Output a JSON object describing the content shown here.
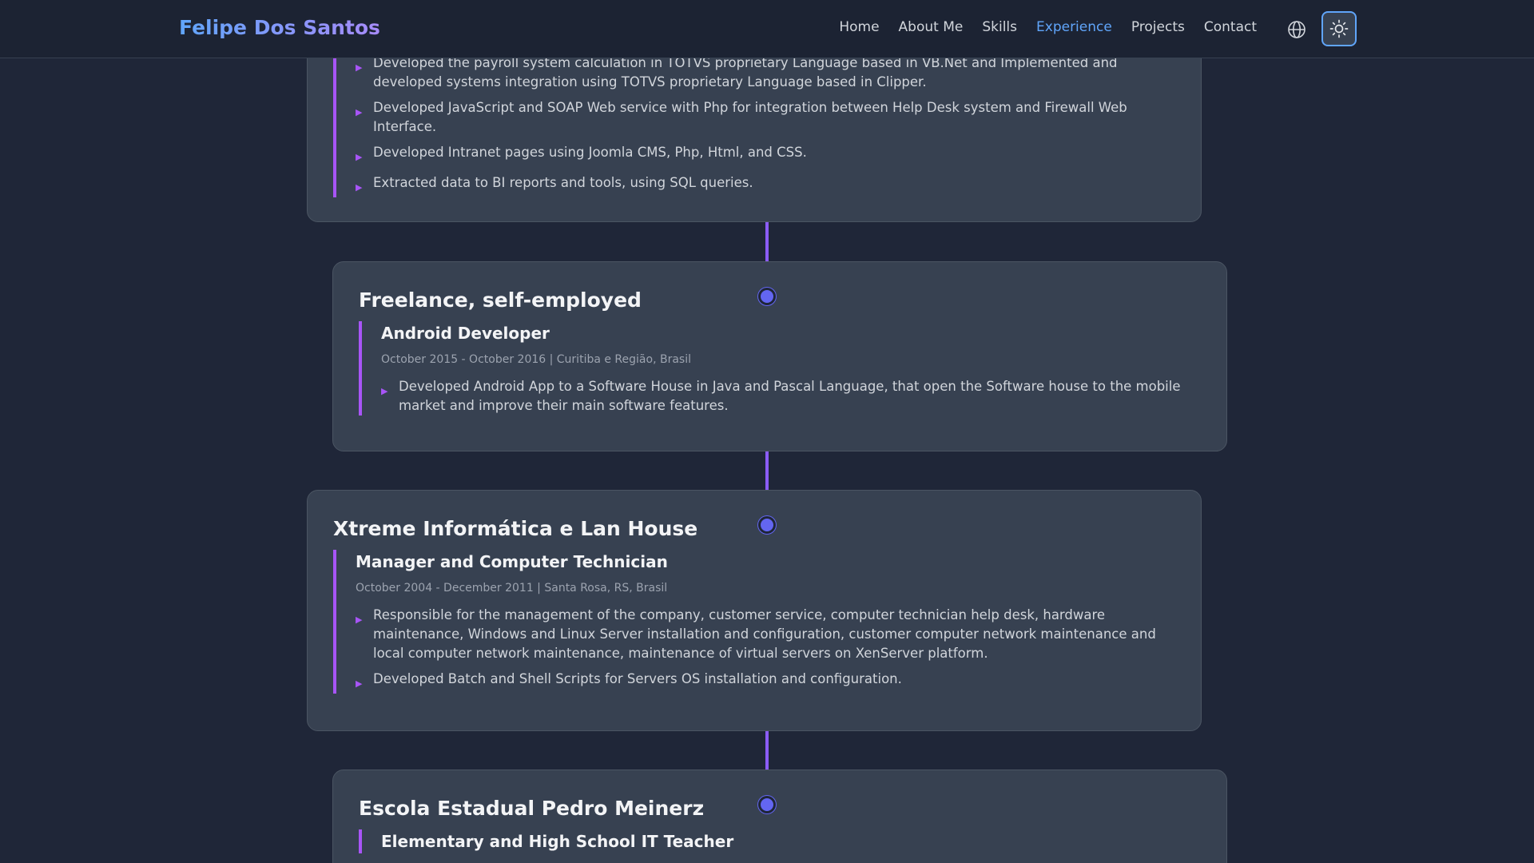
{
  "nav": {
    "brand": "Felipe Dos Santos",
    "links": [
      "Home",
      "About Me",
      "Skills",
      "Experience",
      "Projects",
      "Contact"
    ],
    "active_link": "Experience",
    "language_icon": "globe-icon",
    "theme_icon": "sun-icon"
  },
  "colors": {
    "accent": "#8b5cf6",
    "link_active": "#60a5fa",
    "dot": "#6366f1",
    "background": "#1f2638",
    "card": "#374151"
  },
  "experience": [
    {
      "company": "",
      "role": "",
      "meta": "",
      "bullets": [
        "Developed the payroll system calculation in TOTVS proprietary Language based in VB.Net and Implemented and developed systems integration using TOTVS proprietary Language based in Clipper.",
        "Developed JavaScript and SOAP Web service with Php for integration between Help Desk system and Firewall Web Interface.",
        "Developed Intranet pages using Joomla CMS, Php, Html, and CSS.",
        "Extracted data to BI reports and tools, using SQL queries."
      ]
    },
    {
      "company": "Freelance, self-employed",
      "role": "Android Developer",
      "meta": "October 2015 - October 2016 | Curitiba e Região, Brasil",
      "bullets": [
        "Developed Android App to a Software House in Java and Pascal Language, that open the Software house to the mobile market and improve their main software features."
      ]
    },
    {
      "company": "Xtreme Informática e Lan House",
      "role": "Manager and Computer Technician",
      "meta": "October 2004 - December 2011 | Santa Rosa, RS, Brasil",
      "bullets": [
        "Responsible for the management of the company, customer service, computer technician help desk, hardware maintenance, Windows and Linux Server installation and configuration, customer computer network maintenance and local computer network maintenance, maintenance of virtual servers on XenServer platform.",
        "Developed Batch and Shell Scripts for Servers OS installation and configuration."
      ]
    },
    {
      "company": "Escola Estadual Pedro Meinerz",
      "role": "Elementary and High School IT Teacher",
      "meta": "",
      "bullets": []
    }
  ],
  "bullet_glyph": "▶"
}
